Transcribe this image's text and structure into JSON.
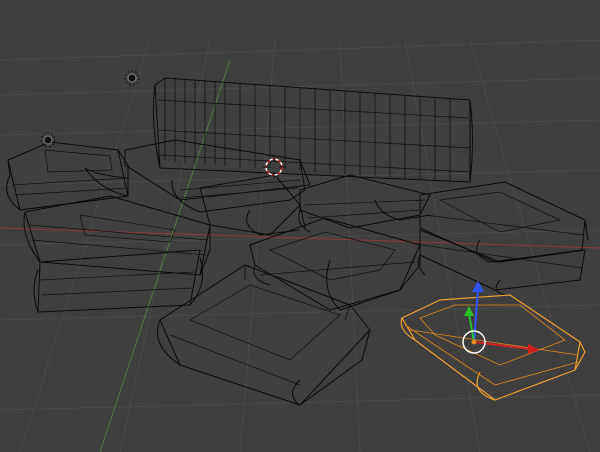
{
  "viewport": {
    "name": "3D Viewport",
    "background": "#3f3f3f",
    "grid_color": "#4a4a4a",
    "x_axis_color": "#8b3a3a",
    "y_axis_color": "#4f7f3a"
  },
  "scene": {
    "wire_color": "#0a0a0a",
    "selected_color": "#f5a030",
    "objects": [
      "book-stack-upright",
      "book-left-front",
      "book-left-back",
      "book-center-front",
      "book-center",
      "book-right-back",
      "book-right-middle",
      "book-selected"
    ]
  },
  "gizmo": {
    "z_axis_color": "#2f55ff",
    "y_axis_color": "#27c027",
    "x_axis_color": "#d02020"
  },
  "icons": {
    "lamp_1": "lamp-icon",
    "lamp_2": "lamp-icon",
    "cursor": "3d-cursor-icon",
    "origin": "object-origin-icon"
  }
}
